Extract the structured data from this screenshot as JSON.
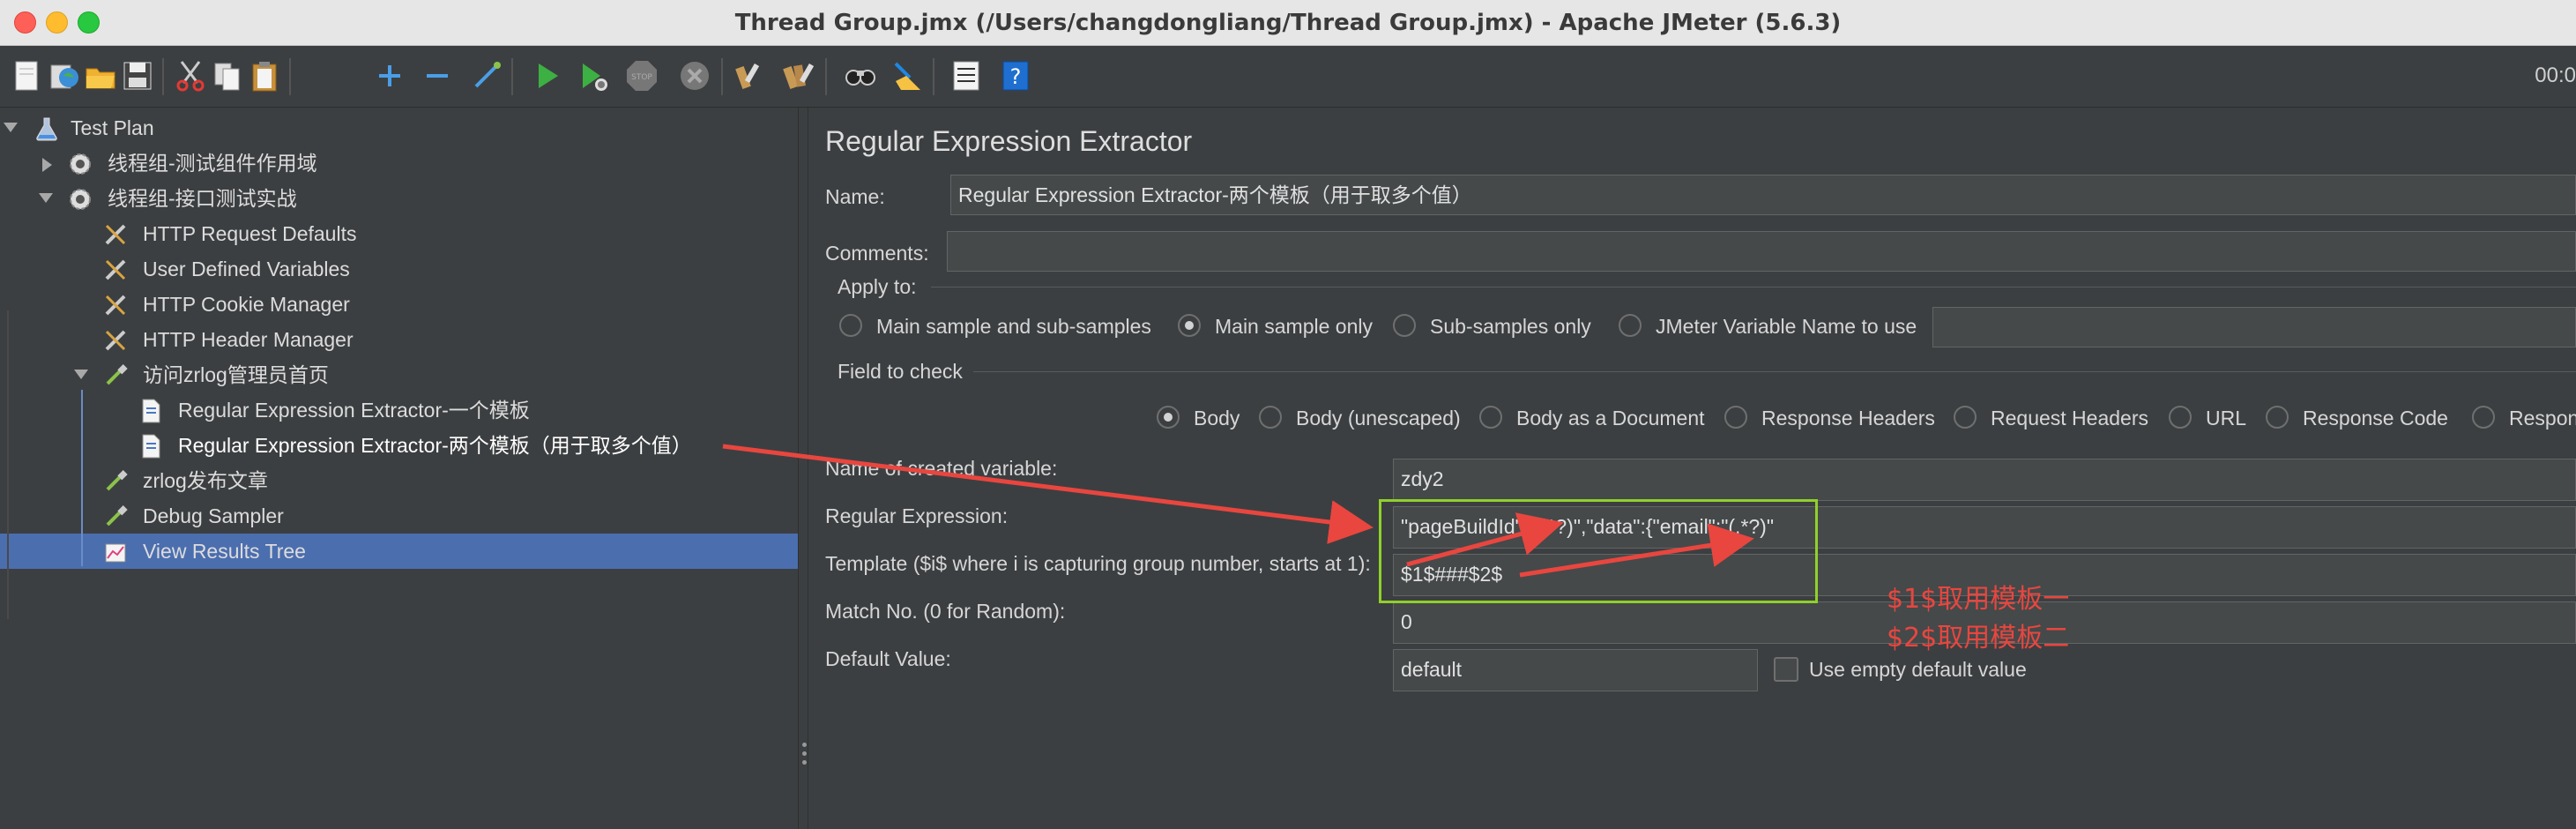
{
  "window": {
    "title": "Thread Group.jmx (/Users/changdongliang/Thread Group.jmx) - Apache JMeter (5.6.3)"
  },
  "toolbar": {
    "timer": "00:0",
    "icons": [
      "new-icon",
      "templates-icon",
      "open-icon",
      "save-icon",
      "cut-icon",
      "copy-icon",
      "paste-icon",
      "expand-icon",
      "collapse-icon",
      "toggle-icon",
      "start-icon",
      "start-no-pause-icon",
      "stop-icon",
      "shutdown-icon",
      "clear-icon",
      "clear-all-icon",
      "search-icon",
      "reset-search-icon",
      "function-helper-icon",
      "help-icon"
    ]
  },
  "tree": {
    "test_plan": "Test Plan",
    "tg1": "线程组-测试组件作用域",
    "tg2": "线程组-接口测试实战",
    "http_defaults": "HTTP Request Defaults",
    "user_vars": "User Defined Variables",
    "cookie_mgr": "HTTP Cookie Manager",
    "header_mgr": "HTTP Header Manager",
    "sampler_home": "访问zrlog管理员首页",
    "extractor_1": "Regular Expression Extractor-一个模板",
    "extractor_2": "Regular Expression Extractor-两个模板（用于取多个值）",
    "sampler_post": "zrlog发布文章",
    "debug_sampler": "Debug Sampler",
    "results_tree": "View Results Tree"
  },
  "form": {
    "title": "Regular Expression Extractor",
    "name_label": "Name:",
    "name_value": "Regular Expression Extractor-两个模板（用于取多个值）",
    "comments_label": "Comments:",
    "comments_value": "",
    "apply_to_label": "Apply to:",
    "apply_options": [
      "Main sample and sub-samples",
      "Main sample only",
      "Sub-samples only",
      "JMeter Variable Name to use"
    ],
    "apply_selected": "Main sample only",
    "field_to_check_label": "Field to check",
    "field_options": [
      "Body",
      "Body (unescaped)",
      "Body as a Document",
      "Response Headers",
      "Request Headers",
      "URL",
      "Response Code",
      "Respon"
    ],
    "field_selected": "Body",
    "var_name_label": "Name of created variable:",
    "var_name_value": "zdy2",
    "regex_label": "Regular Expression:",
    "regex_value": "\"pageBuildId\":\"(.*?)\",\"data\":{\"email\":\"(.*?)\"",
    "template_label": "Template ($i$ where i is capturing group number, starts at 1):",
    "template_value": "$1$###$2$",
    "match_label": "Match No. (0 for Random):",
    "match_value": "0",
    "default_label": "Default Value:",
    "default_value": "default",
    "use_empty_label": "Use empty default value"
  },
  "annotation": {
    "line1": "$1$取用模板一",
    "line2": "$2$取用模板二",
    "color": "#e8463f",
    "box_color": "#90d02a"
  }
}
